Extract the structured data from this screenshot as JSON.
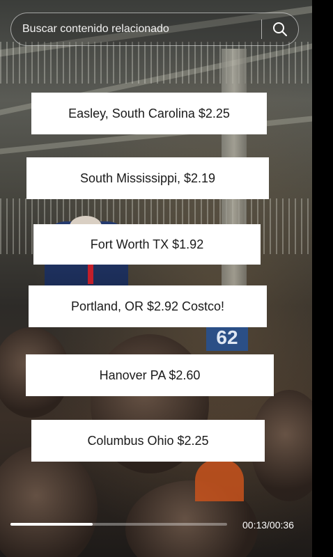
{
  "search": {
    "placeholder": "Buscar contenido relacionado",
    "icon": "search-icon"
  },
  "captions": [
    "Easley, South Carolina $2.25",
    "South Mississippi, $2.19",
    "Fort Worth TX $1.92",
    "Portland, OR $2.92 Costco!",
    "Hanover PA $2.60",
    "Columbus Ohio $2.25"
  ],
  "video": {
    "sign_text": "62",
    "progress_fraction": 0.38,
    "time_label": "00:13/00:36"
  },
  "colors": {
    "caption_bg": "#ffffff",
    "caption_text": "#1a1a1a",
    "progress_fill": "#ffffff"
  }
}
